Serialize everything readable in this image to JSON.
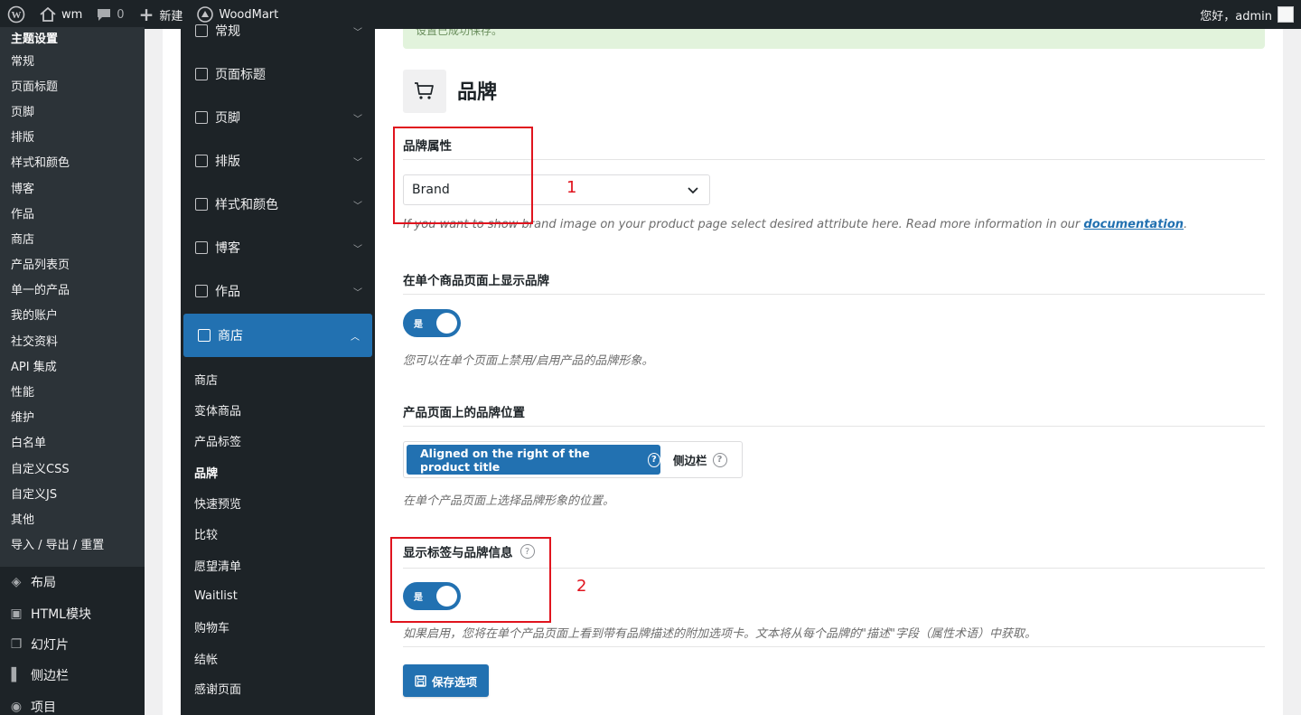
{
  "adminbar": {
    "site_name": "wm",
    "comments_count": "0",
    "new_label": "新建",
    "theme_label": "WoodMart",
    "greeting": "您好，admin"
  },
  "wp_sidebar": {
    "heading": "主题设置",
    "subitems": [
      "常规",
      "页面标题",
      "页脚",
      "排版",
      "样式和颜色",
      "博客",
      "作品",
      "商店",
      "产品列表页",
      "单一的产品",
      "我的账户",
      "社交资料",
      "API 集成",
      "性能",
      "维护",
      "白名单",
      "自定义CSS",
      "自定义JS",
      "其他",
      "导入 / 导出 / 重置"
    ],
    "main_items": [
      "布局",
      "HTML模块",
      "幻灯片",
      "侧边栏",
      "项目"
    ]
  },
  "theme_nav": {
    "items": [
      "常规",
      "页面标题",
      "页脚",
      "排版",
      "样式和颜色",
      "博客",
      "作品",
      "商店"
    ],
    "shop_sub": [
      "商店",
      "变体商品",
      "产品标签",
      "品牌",
      "快速预览",
      "比较",
      "愿望清单",
      "Waitlist",
      "购物车",
      "结帐",
      "感谢页面"
    ]
  },
  "panel": {
    "notice": "设置已成功保存。",
    "section_title": "品牌",
    "brand_attr": {
      "title": "品牌属性",
      "value": "Brand",
      "desc_prefix": "If you want to show brand image on your product page select desired attribute here. Read more information in our ",
      "desc_link": "documentation",
      "desc_suffix": "."
    },
    "show_brand": {
      "title": "在单个商品页面上显示品牌",
      "toggle_label": "是",
      "toggle_on": true,
      "desc": "您可以在单个页面上禁用/启用产品的品牌形象。"
    },
    "brand_position": {
      "title": "产品页面上的品牌位置",
      "options": [
        "Aligned on the right of the product title",
        "侧边栏"
      ],
      "selected": "Aligned on the right of the product title",
      "desc": "在单个产品页面上选择品牌形象的位置。"
    },
    "show_tab": {
      "title": "显示标签与品牌信息",
      "toggle_label": "是",
      "toggle_on": true,
      "desc": "如果启用，您将在单个产品页面上看到带有品牌描述的附加选项卡。文本将从每个品牌的\"描述\"字段（属性术语）中获取。"
    },
    "save_label": "保存选项"
  },
  "annotations": [
    "1",
    "2"
  ],
  "colors": {
    "accent": "#2271b1",
    "annotation_red": "#e0141e",
    "adminbar_bg": "#1d2327",
    "sidebar_bg": "#2c3338"
  }
}
